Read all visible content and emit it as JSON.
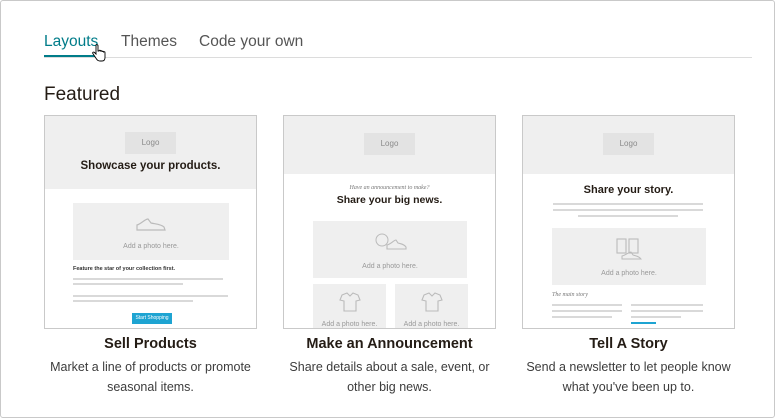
{
  "tabs": [
    {
      "label": "Layouts",
      "active": true
    },
    {
      "label": "Themes",
      "active": false
    },
    {
      "label": "Code your own",
      "active": false
    }
  ],
  "section_title": "Featured",
  "cards": [
    {
      "title": "Sell Products",
      "description_line1": "Market a line of products or promote",
      "description_line2": "seasonal items.",
      "preview": {
        "logo": "Logo",
        "headline": "Showcase your products.",
        "photo_label": "Add a photo here.",
        "subhead": "Feature the star of your collection first.",
        "button": "Start Shopping"
      }
    },
    {
      "title": "Make an Announcement",
      "description_line1": "Share details about a sale, event, or",
      "description_line2": "other big news.",
      "preview": {
        "logo": "Logo",
        "kicker": "Have an announcement to make?",
        "headline": "Share your big news.",
        "photo_label": "Add a photo here.",
        "photo_label_2": "Add a photo here.",
        "photo_label_3": "Add a photo here."
      }
    },
    {
      "title": "Tell A Story",
      "description_line1": "Send a newsletter to let people know",
      "description_line2": "what you've been up to.",
      "preview": {
        "logo": "Logo",
        "headline": "Share your story.",
        "photo_label": "Add a photo here.",
        "kicker": "The main story"
      }
    }
  ],
  "colors": {
    "accent": "#007c89",
    "button": "#1ea4d2"
  }
}
